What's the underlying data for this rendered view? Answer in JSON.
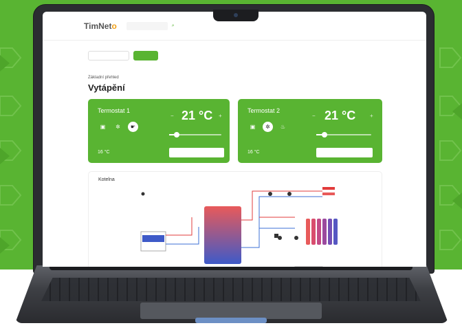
{
  "app": {
    "logo_main": "TimNet",
    "logo_accent": "o",
    "search_placeholder": "",
    "nav": [
      "",
      ""
    ]
  },
  "tabs": [
    {
      "label": "",
      "active": false
    },
    {
      "label": "",
      "active": true
    }
  ],
  "page": {
    "subtitle": "Základní přehled",
    "title": "Vytápění"
  },
  "thermostats": [
    {
      "name": "Termostat 1",
      "set_label": "",
      "setpoint": "21 °C",
      "measured_label": "",
      "measured_value": "16 °C",
      "slider_label": "",
      "slider_level": 0.15,
      "modes": [
        "sun-icon",
        "snowflake-icon",
        "hand-icon"
      ],
      "active_mode": 2,
      "button_label": ""
    },
    {
      "name": "Termostat 2",
      "set_label": "",
      "setpoint": "21 °C",
      "measured_label": "",
      "measured_value": "16 °C",
      "slider_label": "",
      "slider_level": 0.15,
      "modes": [
        "sun-icon",
        "snowflake-icon",
        "hand-icon"
      ],
      "active_mode": 1,
      "button_label": ""
    }
  ],
  "diagram": {
    "title": "Kotelna",
    "labels": [
      "",
      "",
      ""
    ],
    "colors": {
      "hot": "#e23b3b",
      "cold": "#3b6fd6",
      "tank_top": "#e85a5a",
      "tank_bottom": "#3e5ac8"
    }
  },
  "colors": {
    "accent": "#59b432",
    "bezel": "#2b2d31"
  }
}
